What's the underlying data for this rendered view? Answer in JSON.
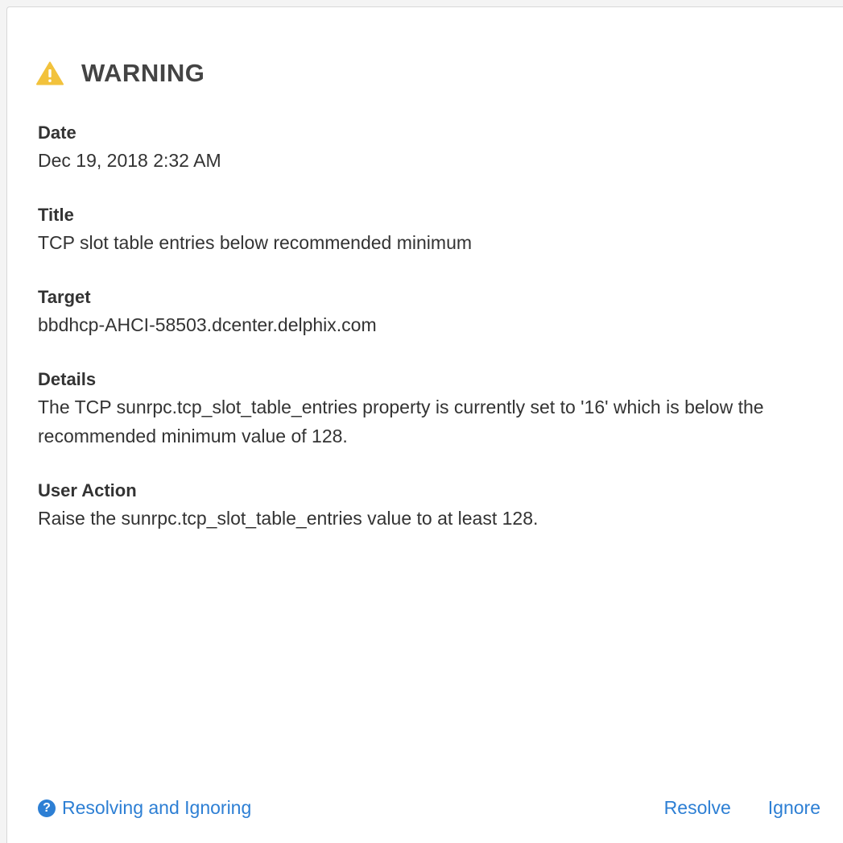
{
  "header": {
    "severity": "WARNING",
    "icon": "warning-triangle-icon",
    "icon_color": "#f2c23c"
  },
  "fields": [
    {
      "label": "Date",
      "value": "Dec 19, 2018 2:32 AM"
    },
    {
      "label": "Title",
      "value": "TCP slot table entries below recommended minimum"
    },
    {
      "label": "Target",
      "value": "bbdhcp-AHCI-58503.dcenter.delphix.com"
    },
    {
      "label": "Details",
      "value": "The TCP sunrpc.tcp_slot_table_entries property is currently set to '16' which is below the recommended minimum value of 128."
    },
    {
      "label": "User Action",
      "value": "Raise the sunrpc.tcp_slot_table_entries value to at least 128."
    }
  ],
  "footer": {
    "help_link": "Resolving and Ignoring",
    "help_icon": "question-circle-icon",
    "resolve_label": "Resolve",
    "ignore_label": "Ignore",
    "link_color": "#2d7fd4"
  }
}
